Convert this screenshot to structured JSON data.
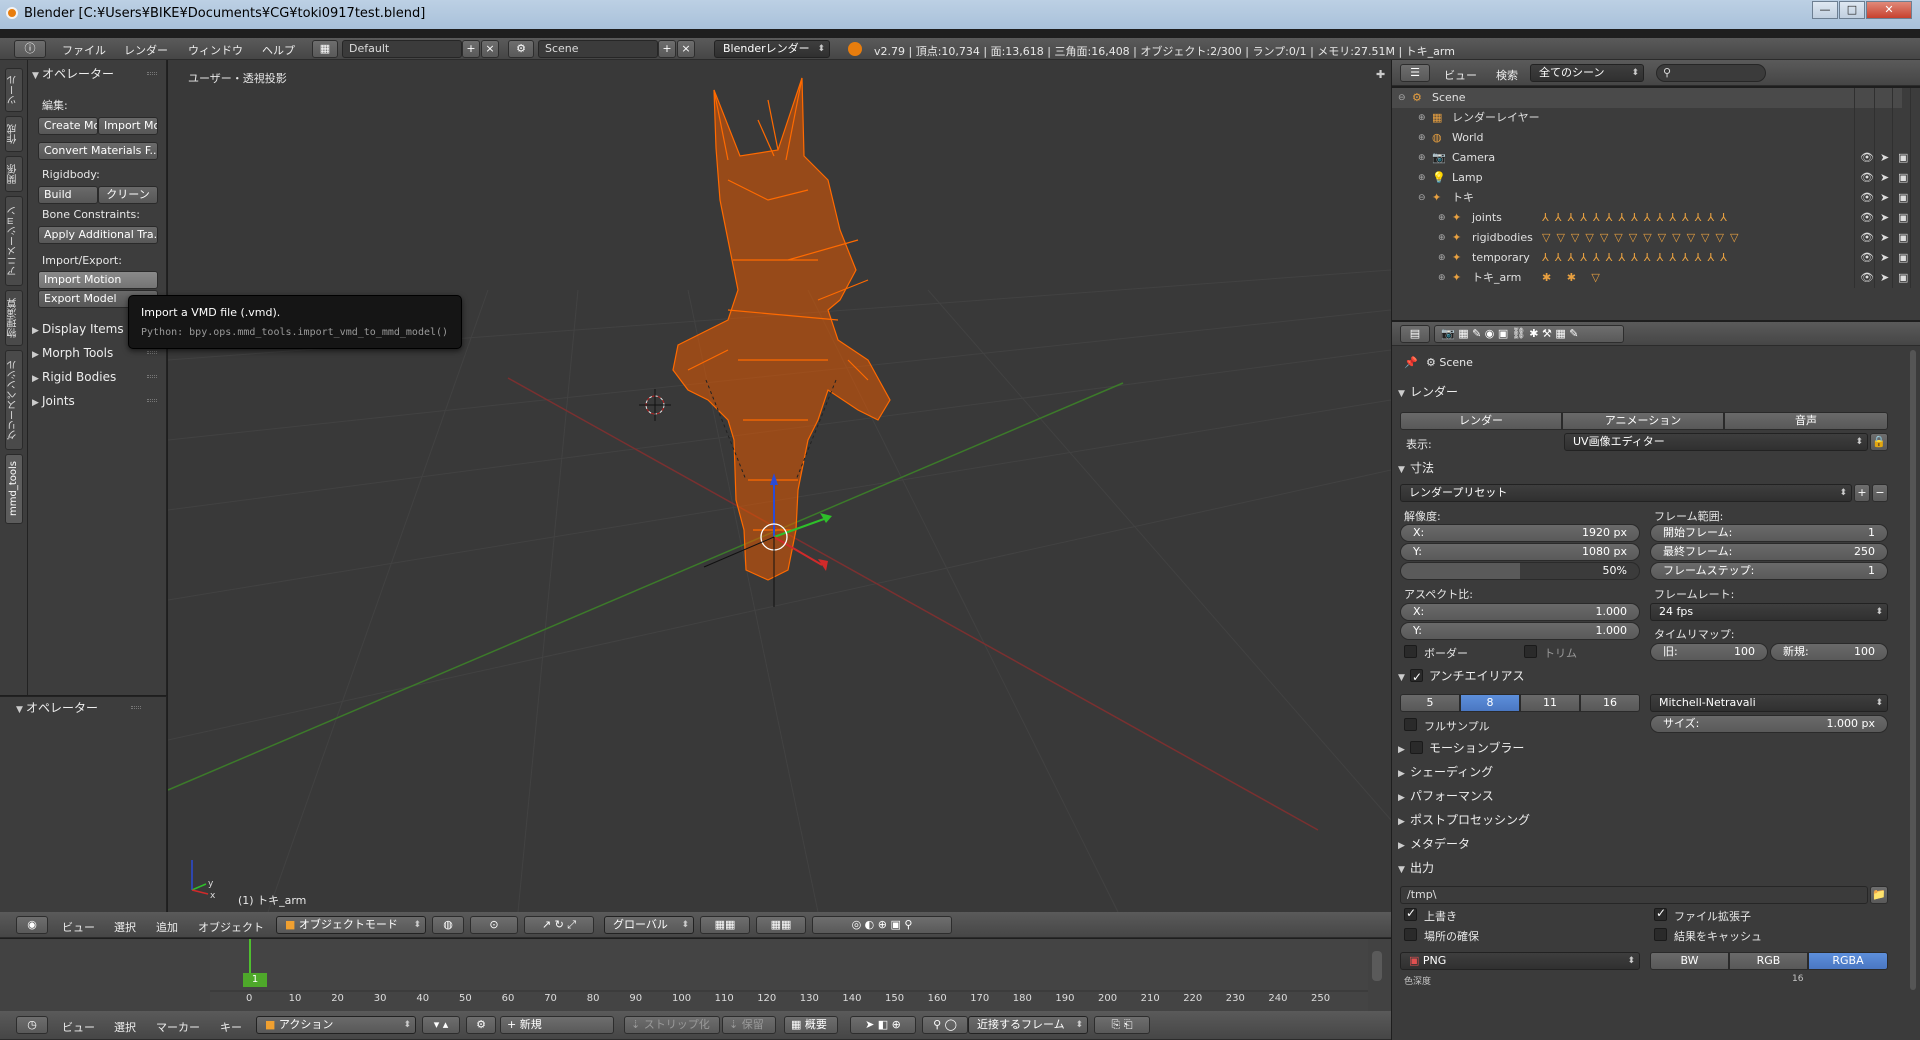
{
  "window": {
    "title": "Blender [C:¥Users¥BIKE¥Documents¥CG¥toki0917test.blend]",
    "min": "—",
    "max": "□",
    "close": "✕"
  },
  "info": {
    "menus": [
      "ファイル",
      "レンダー",
      "ウィンドウ",
      "ヘルプ"
    ],
    "layout": "Default",
    "scene": "Scene",
    "engine": "Blenderレンダー",
    "stats": "v2.79 | 頂点:10,734 | 面:13,618 | 三角面:16,408 | オブジェクト:2/300 | ランプ:0/1 | メモリ:27.51M | トキ_arm"
  },
  "toolshelf": {
    "tabs": [
      "ツール",
      "作成",
      "関係",
      "アニメーション",
      "物理演算",
      "グリースペンシル",
      "mmd_tools"
    ],
    "operator_title": "オペレーター",
    "edit_label": "編集:",
    "create_model": "Create Mo",
    "import_model": "Import Mo",
    "convert_materials": "Convert Materials F...",
    "rigidbody_label": "Rigidbody:",
    "build": "Build",
    "clean": "クリーン",
    "bone_constraints_label": "Bone Constraints:",
    "apply_additional": "Apply Additional Tra...",
    "import_export_label": "Import/Export:",
    "import_motion": "Import Motion",
    "export_model": "Export Model",
    "panels": [
      "Display Items",
      "Morph Tools",
      "Rigid Bodies",
      "Joints"
    ],
    "operator_title2": "オペレーター"
  },
  "tooltip": {
    "title": "Import a VMD file (.vmd).",
    "python": "Python: bpy.ops.mmd_tools.import_vmd_to_mmd_model()"
  },
  "viewport": {
    "view_label": "ユーザー・透視投影",
    "object_label": "(1) トキ_arm",
    "axis_y": "y",
    "axis_x": "x"
  },
  "viewport_header": {
    "menus": [
      "ビュー",
      "選択",
      "追加",
      "オブジェクト"
    ],
    "mode": "オブジェクトモード",
    "orientation": "グローバル"
  },
  "timeline": {
    "ticks": [
      "0",
      "10",
      "20",
      "30",
      "40",
      "50",
      "60",
      "70",
      "80",
      "90",
      "100",
      "110",
      "120",
      "130",
      "140",
      "150",
      "160",
      "170",
      "180",
      "190",
      "200",
      "210",
      "220",
      "230",
      "240",
      "250"
    ],
    "current_frame": "1"
  },
  "timeline_header": {
    "menus": [
      "ビュー",
      "選択",
      "マーカー",
      "キー"
    ],
    "action": "アクション",
    "new": "新規",
    "strip": "ストリップ化",
    "keep": "保留",
    "summary": "概要",
    "nearest": "近接するフレーム"
  },
  "outliner": {
    "menus": [
      "ビュー",
      "検索"
    ],
    "filter": "全てのシーン",
    "rows": [
      {
        "name": "Scene",
        "indent": 0
      },
      {
        "name": "レンダーレイヤー",
        "indent": 1
      },
      {
        "name": "World",
        "indent": 1
      },
      {
        "name": "Camera",
        "indent": 1
      },
      {
        "name": "Lamp",
        "indent": 1
      },
      {
        "name": "トキ",
        "indent": 1
      },
      {
        "name": "joints",
        "indent": 2
      },
      {
        "name": "rigidbodies",
        "indent": 2
      },
      {
        "name": "temporary",
        "indent": 2
      },
      {
        "name": "トキ_arm",
        "indent": 2
      }
    ]
  },
  "props": {
    "scene": "Scene",
    "render_section": "レンダー",
    "render_btn": "レンダー",
    "anim_btn": "アニメーション",
    "audio_btn": "音声",
    "display_label": "表示:",
    "display_value": "UV画像エディター",
    "dimensions": "寸法",
    "render_presets": "レンダープリセット",
    "resolution_label": "解像度:",
    "res_x_k": "X:",
    "res_x": "1920 px",
    "res_y_k": "Y:",
    "res_y": "1080 px",
    "res_pct": "50%",
    "frame_range_label": "フレーム範囲:",
    "start_k": "開始フレーム:",
    "start": "1",
    "end_k": "最終フレーム:",
    "end": "250",
    "step_k": "フレームステップ:",
    "step": "1",
    "aspect_label": "アスペクト比:",
    "asp_x_k": "X:",
    "asp_x": "1.000",
    "asp_y_k": "Y:",
    "asp_y": "1.000",
    "framerate_label": "フレームレート:",
    "framerate": "24 fps",
    "timeremap_label": "タイムリマップ:",
    "old_k": "旧:",
    "old": "100",
    "new_k": "新規:",
    "new": "100",
    "border": "ボーダー",
    "crop": "トリム",
    "antialias": "アンチエイリアス",
    "aa_samples": [
      "5",
      "8",
      "11",
      "16"
    ],
    "aa_filter": "Mitchell-Netravali",
    "full_sample": "フルサンプル",
    "size_k": "サイズ:",
    "size": "1.000 px",
    "collapsed": [
      "モーションブラー",
      "シェーディング",
      "パフォーマンス",
      "ポストプロセッシング",
      "メタデータ"
    ],
    "output": "出力",
    "output_path": "/tmp\\",
    "overwrite": "上書き",
    "file_ext": "ファイル拡張子",
    "placeholders": "場所の確保",
    "cache_result": "結果をキャッシュ",
    "format": "PNG",
    "color_modes": [
      "BW",
      "RGB",
      "RGBA"
    ],
    "partial1": "色深度",
    "partial2": "16"
  },
  "colors": {
    "accent": "#5680c2",
    "model": "#ff6a00"
  }
}
